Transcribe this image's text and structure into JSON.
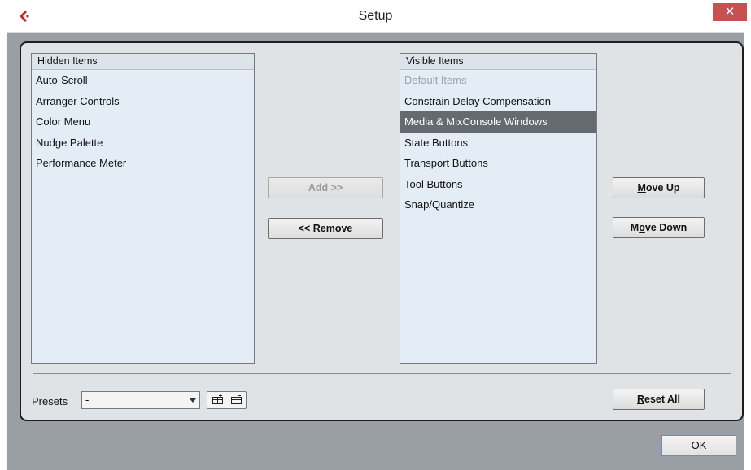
{
  "window": {
    "title": "Setup",
    "close_glyph": "✕"
  },
  "hidden": {
    "header": "Hidden Items",
    "items": [
      "Auto-Scroll",
      "Arranger Controls",
      "Color Menu",
      "Nudge Palette",
      "Performance Meter"
    ]
  },
  "visible": {
    "header": "Visible Items",
    "items": [
      {
        "label": "Default Items",
        "state": "disabled"
      },
      {
        "label": "Constrain Delay Compensation",
        "state": "normal"
      },
      {
        "label": "Media & MixConsole Windows",
        "state": "selected"
      },
      {
        "label": "State Buttons",
        "state": "normal"
      },
      {
        "label": "Transport Buttons",
        "state": "normal"
      },
      {
        "label": "Tool Buttons",
        "state": "normal"
      },
      {
        "label": "Snap/Quantize",
        "state": "normal"
      }
    ]
  },
  "buttons": {
    "add": "Add >>",
    "remove_prefix": "<< ",
    "remove_accel": "R",
    "remove_rest": "emove",
    "move_up_accel": "M",
    "move_up_rest": "ove Up",
    "move_down_pre": "M",
    "move_down_accel": "o",
    "move_down_rest": "ve Down",
    "reset_accel": "R",
    "reset_rest": "eset All",
    "ok": "OK"
  },
  "presets": {
    "label": "Presets",
    "value": "-"
  },
  "icons": [
    "app-logo-icon",
    "close-icon",
    "chevron-down-icon",
    "save-preset-icon",
    "delete-preset-icon"
  ],
  "colors": {
    "accent": "#c0282d",
    "selected_row": "#646a70",
    "close": "#c75050"
  }
}
